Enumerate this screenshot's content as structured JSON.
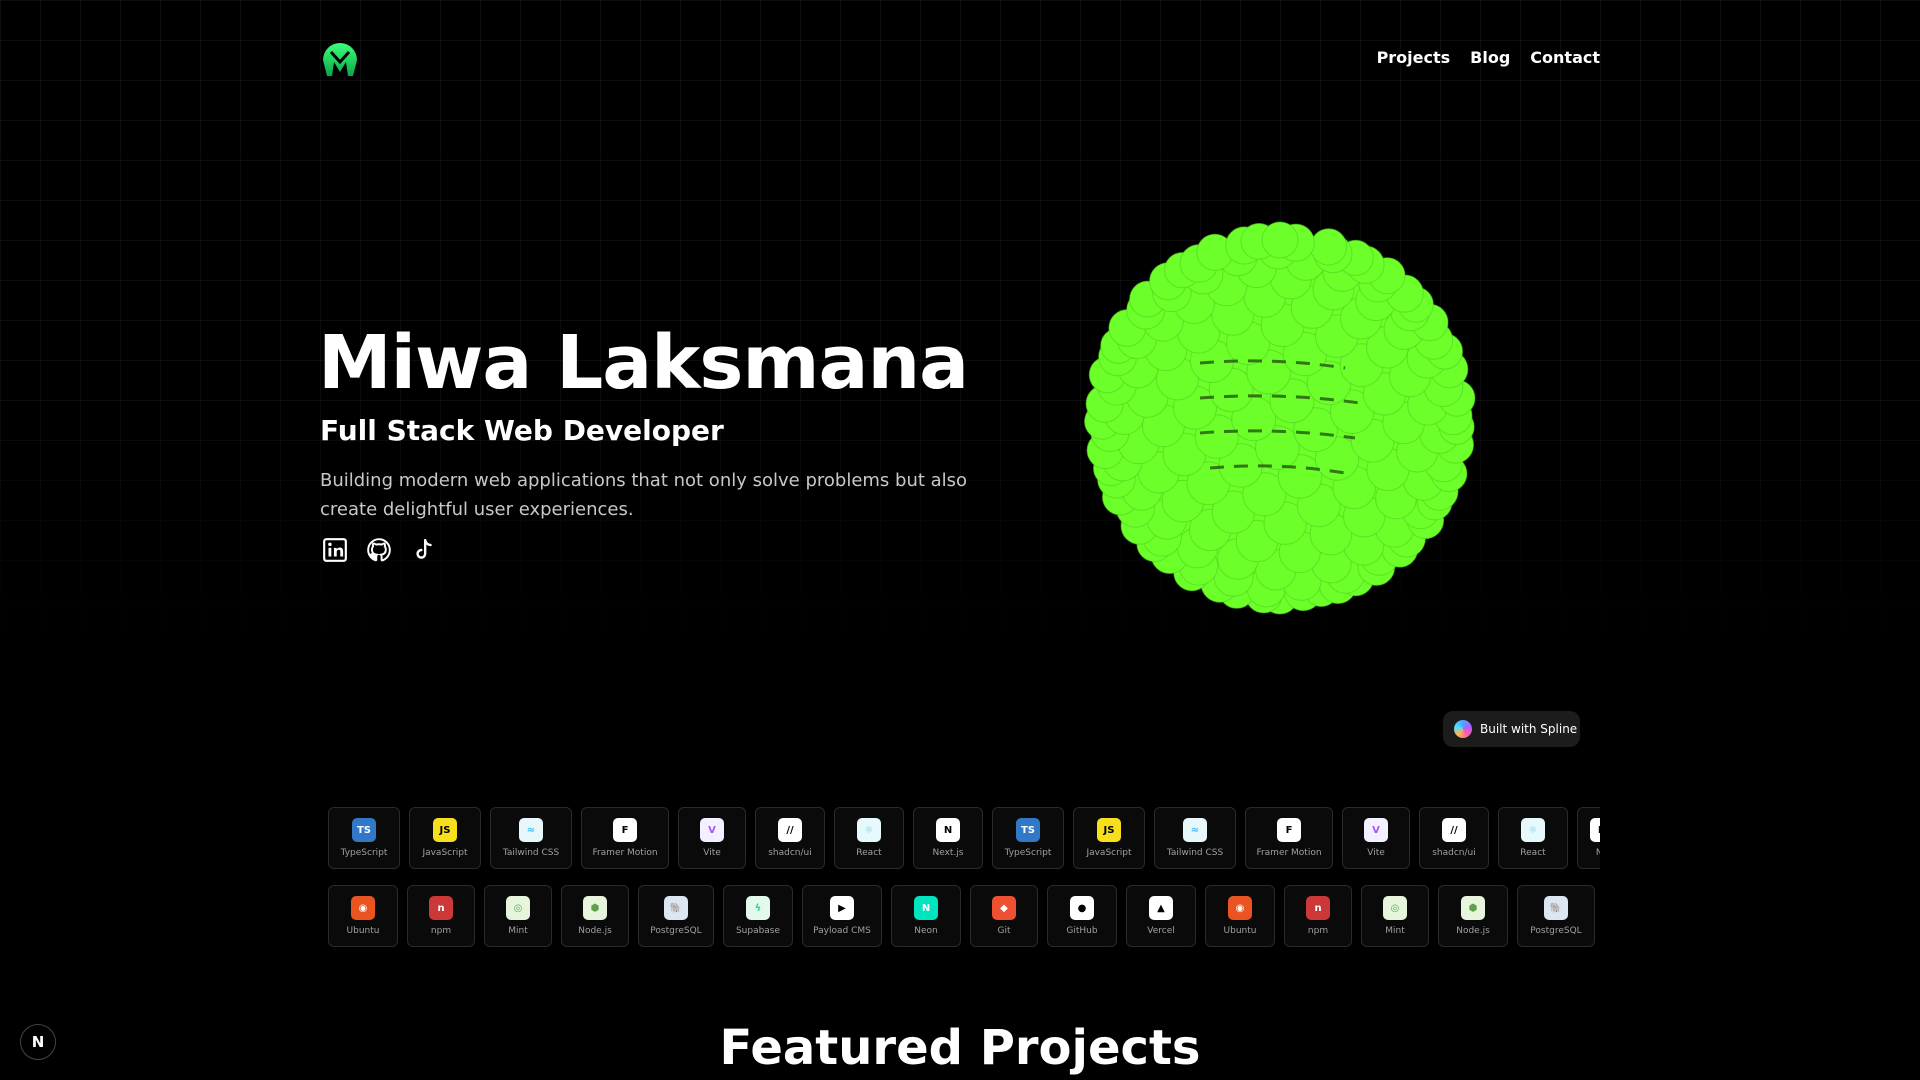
{
  "header": {
    "logo_icon": "m-logo-icon",
    "nav": [
      {
        "label": "Projects"
      },
      {
        "label": "Blog"
      },
      {
        "label": "Contact"
      }
    ]
  },
  "hero": {
    "name": "Miwa Laksmana",
    "role": "Full Stack Web Developer",
    "description": "Building modern web applications that not only solve problems but also create delightful user experiences.",
    "socials": [
      {
        "icon": "linkedin-icon"
      },
      {
        "icon": "github-icon"
      },
      {
        "icon": "tiktok-icon"
      }
    ],
    "accent_color": "#6cff2a"
  },
  "spline_badge": {
    "label": "Built with Spline"
  },
  "tech_row_1": [
    {
      "label": "TypeScript",
      "icon": "typescript-icon",
      "glyph": "TS",
      "bg": "#3178c6",
      "fg": "#ffffff"
    },
    {
      "label": "JavaScript",
      "icon": "javascript-icon",
      "glyph": "JS",
      "bg": "#f7df1e",
      "fg": "#000000"
    },
    {
      "label": "Tailwind CSS",
      "icon": "tailwind-icon",
      "glyph": "≈",
      "bg": "#e8f7fb",
      "fg": "#38bdf8"
    },
    {
      "label": "Framer Motion",
      "icon": "framer-motion-icon",
      "glyph": "F",
      "bg": "#ffffff",
      "fg": "#000000"
    },
    {
      "label": "Vite",
      "icon": "vite-icon",
      "glyph": "V",
      "bg": "#f3f0ff",
      "fg": "#a855f7"
    },
    {
      "label": "shadcn/ui",
      "icon": "shadcn-icon",
      "glyph": "//",
      "bg": "#ffffff",
      "fg": "#000000"
    },
    {
      "label": "React",
      "icon": "react-icon",
      "glyph": "⚛",
      "bg": "#e6f9fd",
      "fg": "#61dafb"
    },
    {
      "label": "Next.js",
      "icon": "nextjs-icon",
      "glyph": "N",
      "bg": "#ffffff",
      "fg": "#000000"
    },
    {
      "label": "TypeScript",
      "icon": "typescript-icon",
      "glyph": "TS",
      "bg": "#3178c6",
      "fg": "#ffffff"
    },
    {
      "label": "JavaScript",
      "icon": "javascript-icon",
      "glyph": "JS",
      "bg": "#f7df1e",
      "fg": "#000000"
    },
    {
      "label": "Tailwind CSS",
      "icon": "tailwind-icon",
      "glyph": "≈",
      "bg": "#e8f7fb",
      "fg": "#38bdf8"
    },
    {
      "label": "Framer Motion",
      "icon": "framer-motion-icon",
      "glyph": "F",
      "bg": "#ffffff",
      "fg": "#000000"
    },
    {
      "label": "Vite",
      "icon": "vite-icon",
      "glyph": "V",
      "bg": "#f3f0ff",
      "fg": "#a855f7"
    },
    {
      "label": "shadcn/ui",
      "icon": "shadcn-icon",
      "glyph": "//",
      "bg": "#ffffff",
      "fg": "#000000"
    },
    {
      "label": "React",
      "icon": "react-icon",
      "glyph": "⚛",
      "bg": "#e6f9fd",
      "fg": "#61dafb"
    },
    {
      "label": "Ne",
      "icon": "nextjs-icon",
      "glyph": "N",
      "bg": "#ffffff",
      "fg": "#000000"
    }
  ],
  "tech_row_2": [
    {
      "label": "Ubuntu",
      "icon": "ubuntu-icon",
      "glyph": "◉",
      "bg": "#e95420",
      "fg": "#ffffff"
    },
    {
      "label": "npm",
      "icon": "npm-icon",
      "glyph": "n",
      "bg": "#cb3837",
      "fg": "#ffffff"
    },
    {
      "label": "Mint",
      "icon": "mint-icon",
      "glyph": "◎",
      "bg": "#e6f5dc",
      "fg": "#4caf50"
    },
    {
      "label": "Node.js",
      "icon": "nodejs-icon",
      "glyph": "⬢",
      "bg": "#e6f5dc",
      "fg": "#5fa04e"
    },
    {
      "label": "PostgreSQL",
      "icon": "postgresql-icon",
      "glyph": "🐘",
      "bg": "#dce6f2",
      "fg": "#336791"
    },
    {
      "label": "Supabase",
      "icon": "supabase-icon",
      "glyph": "ϟ",
      "bg": "#e4f9ee",
      "fg": "#3ecf8e"
    },
    {
      "label": "Payload CMS",
      "icon": "payload-cms-icon",
      "glyph": "▶",
      "bg": "#ffffff",
      "fg": "#000000"
    },
    {
      "label": "Neon",
      "icon": "neon-icon",
      "glyph": "N",
      "bg": "#00e5bf",
      "fg": "#ffffff"
    },
    {
      "label": "Git",
      "icon": "git-icon",
      "glyph": "◆",
      "bg": "#f05032",
      "fg": "#ffffff"
    },
    {
      "label": "GitHub",
      "icon": "github-icon",
      "glyph": "●",
      "bg": "#ffffff",
      "fg": "#000000"
    },
    {
      "label": "Vercel",
      "icon": "vercel-icon",
      "glyph": "▲",
      "bg": "#ffffff",
      "fg": "#000000"
    },
    {
      "label": "Ubuntu",
      "icon": "ubuntu-icon",
      "glyph": "◉",
      "bg": "#e95420",
      "fg": "#ffffff"
    },
    {
      "label": "npm",
      "icon": "npm-icon",
      "glyph": "n",
      "bg": "#cb3837",
      "fg": "#ffffff"
    },
    {
      "label": "Mint",
      "icon": "mint-icon",
      "glyph": "◎",
      "bg": "#e6f5dc",
      "fg": "#4caf50"
    },
    {
      "label": "Node.js",
      "icon": "nodejs-icon",
      "glyph": "⬢",
      "bg": "#e6f5dc",
      "fg": "#5fa04e"
    },
    {
      "label": "PostgreSQL",
      "icon": "postgresql-icon",
      "glyph": "🐘",
      "bg": "#dce6f2",
      "fg": "#336791"
    }
  ],
  "featured": {
    "title": "Featured Projects"
  },
  "next_badge": {
    "label": "N"
  }
}
